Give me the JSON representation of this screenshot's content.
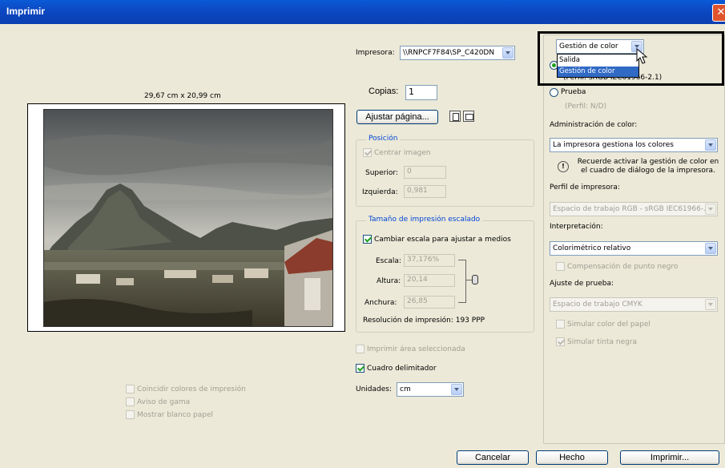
{
  "window": {
    "title": "Imprimir"
  },
  "preview": {
    "dimensions": "29,67 cm x 20,99 cm"
  },
  "printer": {
    "label": "Impresora:",
    "value": "\\\\RNPCF7F84\\SP_C420DN"
  },
  "copies": {
    "label": "Copias:",
    "value": "1"
  },
  "page_setup_button": "Ajustar página...",
  "position": {
    "title": "Posición",
    "center_label": "Centrar imagen",
    "top_label": "Superior:",
    "top_value": "0",
    "left_label": "Izquierda:",
    "left_value": "0,981"
  },
  "scaled": {
    "title": "Tamaño de impresión escalado",
    "fit_label": "Cambiar escala para ajustar a medios",
    "scale_label": "Escala:",
    "scale_value": "37,176%",
    "height_label": "Altura:",
    "height_value": "20,14",
    "width_label": "Anchura:",
    "width_value": "26,85",
    "resolution": "Resolución de impresión: 193 PPP"
  },
  "print_selected_label": "Imprimir área seleccionada",
  "bounding_box_label": "Cuadro delimitador",
  "units": {
    "label": "Unidades:",
    "value": "cm"
  },
  "left_options": [
    "Coincidir colores de impresión",
    "Aviso de gama",
    "Mostrar blanco papel"
  ],
  "color_dropdown": {
    "value": "Gestión de color",
    "options": [
      "Salida",
      "Gestión de color"
    ],
    "partial_behind": "(Perfil: sRGB IEC61966-2.1)"
  },
  "color_panel": {
    "proof_label": "Prueba",
    "proof_profile": "(Perfil: N/D)",
    "color_handling_label": "Administración de color:",
    "color_handling_value": "La impresora gestiona los colores",
    "notice": "Recuerde activar la gestión de color en el cuadro de diálogo de la impresora.",
    "printer_profile_label": "Perfil de impresora:",
    "printer_profile_value": "Espacio de trabajo RGB - sRGB IEC61966-...",
    "intent_label": "Interpretación:",
    "intent_value": "Colorimétrico relativo",
    "bpc_label": "Compensación de punto negro",
    "proof_setup_label": "Ajuste de prueba:",
    "proof_setup_value": "Espacio de trabajo CMYK",
    "simulate_paper_label": "Simular color del papel",
    "simulate_ink_label": "Simular tinta negra"
  },
  "buttons": {
    "cancel": "Cancelar",
    "done": "Hecho",
    "print": "Imprimir..."
  },
  "colors": {
    "titlebar": "#0c49c4",
    "dialog_bg": "#ece9d8",
    "group_title": "#0046d5",
    "selection": "#316ac5"
  }
}
